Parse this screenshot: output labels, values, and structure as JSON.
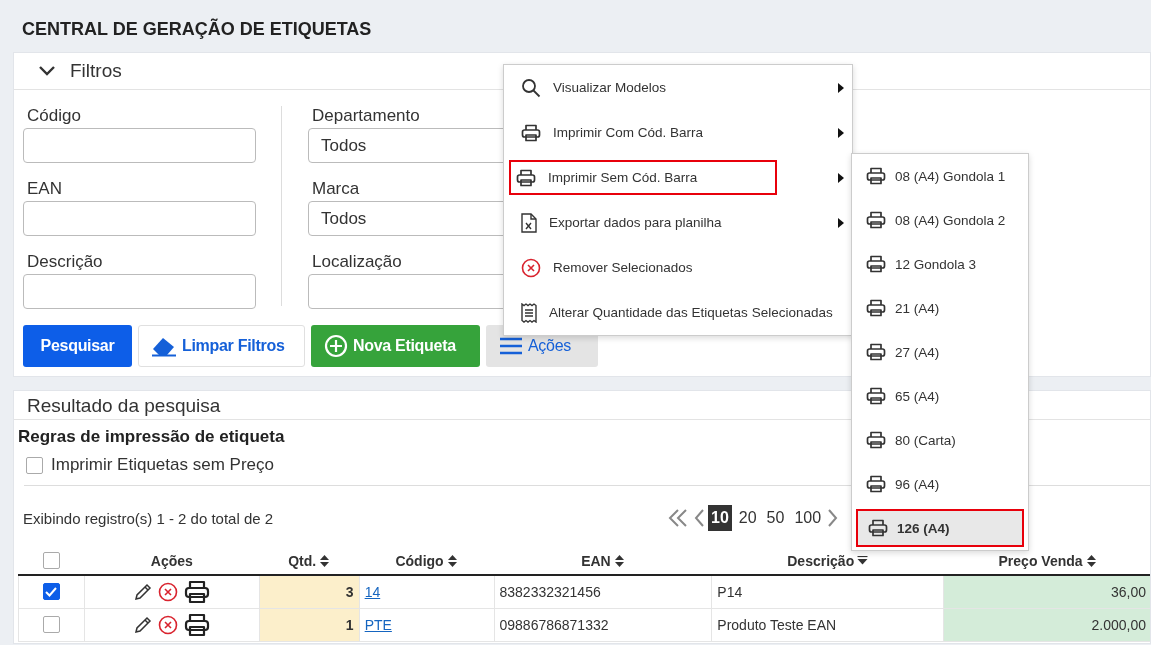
{
  "title": "CENTRAL DE GERAÇÃO DE ETIQUETAS",
  "filters": {
    "title": "Filtros",
    "expanded": true,
    "columns": [
      [
        {
          "label": "Código"
        },
        {
          "label": "EAN"
        },
        {
          "label": "Descrição"
        }
      ],
      [
        {
          "label": "Departamento",
          "value": "Todos"
        },
        {
          "label": "Marca",
          "value": "Todos"
        },
        {
          "label": "Localização"
        }
      ]
    ],
    "buttons": [
      {
        "label": "Pesquisar",
        "kind": "primary"
      },
      {
        "label": "Limpar Filtros",
        "kind": "clear"
      },
      {
        "label": "Nova Etiqueta",
        "kind": "add"
      },
      {
        "label": "Ações",
        "kind": "menu"
      }
    ]
  },
  "menu": {
    "items": [
      {
        "label": "Visualizar Modelos",
        "kind": "search",
        "submenu": true,
        "selected": false
      },
      {
        "label": "Imprimir Com Cód. Barra",
        "kind": "print",
        "submenu": true,
        "selected": false
      },
      {
        "label": "Imprimir Sem Cód. Barra",
        "kind": "print",
        "submenu": true,
        "selected": true
      },
      {
        "label": "Exportar dados para planilha",
        "kind": "export",
        "submenu": true,
        "selected": false
      },
      {
        "label": "Remover Selecionados",
        "kind": "remove",
        "submenu": false,
        "selected": false
      },
      {
        "label": "Alterar Quantidade das Etiquetas Selecionadas",
        "kind": "quantity",
        "submenu": false,
        "selected": false
      }
    ]
  },
  "submenu": {
    "items": [
      {
        "label": "08 (A4) Gondola 1",
        "selected": false
      },
      {
        "label": "08 (A4) Gondola 2",
        "selected": false
      },
      {
        "label": "12 Gondola 3",
        "selected": false
      },
      {
        "label": "21 (A4)",
        "selected": false
      },
      {
        "label": "27 (A4)",
        "selected": false
      },
      {
        "label": "65 (A4)",
        "selected": false
      },
      {
        "label": "80 (Carta)",
        "selected": false
      },
      {
        "label": "96 (A4)",
        "selected": false
      },
      {
        "label": "126 (A4)",
        "selected": true
      }
    ]
  },
  "results": {
    "title": "Resultado da pesquisa",
    "rules_title": "Regras de impressão de etiqueta",
    "rules": [
      {
        "label": "Imprimir Etiquetas sem Preço",
        "checked": false
      }
    ],
    "summary": "Exibindo registro(s) 1 - 2 do total de 2",
    "page_sizes": [
      {
        "label": "10",
        "selected": true
      },
      {
        "label": "20",
        "selected": false
      },
      {
        "label": "50",
        "selected": false
      },
      {
        "label": "100",
        "selected": false
      }
    ],
    "columns": [
      {
        "kind": "checkbox",
        "checked": false
      },
      {
        "kind": "text",
        "label": "Ações"
      },
      {
        "kind": "text",
        "label": "Qtd.",
        "sortable": true,
        "sorted": false
      },
      {
        "kind": "text",
        "label": "Código",
        "sortable": true,
        "sorted": false
      },
      {
        "kind": "text",
        "label": "EAN",
        "sortable": true,
        "sorted": false
      },
      {
        "kind": "text",
        "label": "Descrição",
        "sortable": true,
        "sorted": true
      },
      {
        "kind": "text",
        "label": "Preço Venda",
        "sortable": true,
        "sorted": false
      }
    ],
    "rows": [
      {
        "selected": true,
        "qtd": "3",
        "codigo": "14",
        "ean": "8382332321456",
        "descricao": "P14",
        "preco": "36,00"
      },
      {
        "selected": false,
        "qtd": "1",
        "codigo": "PTE",
        "ean": "09886786871332",
        "descricao": "Produto Teste EAN",
        "preco": "2.000,00"
      }
    ]
  }
}
